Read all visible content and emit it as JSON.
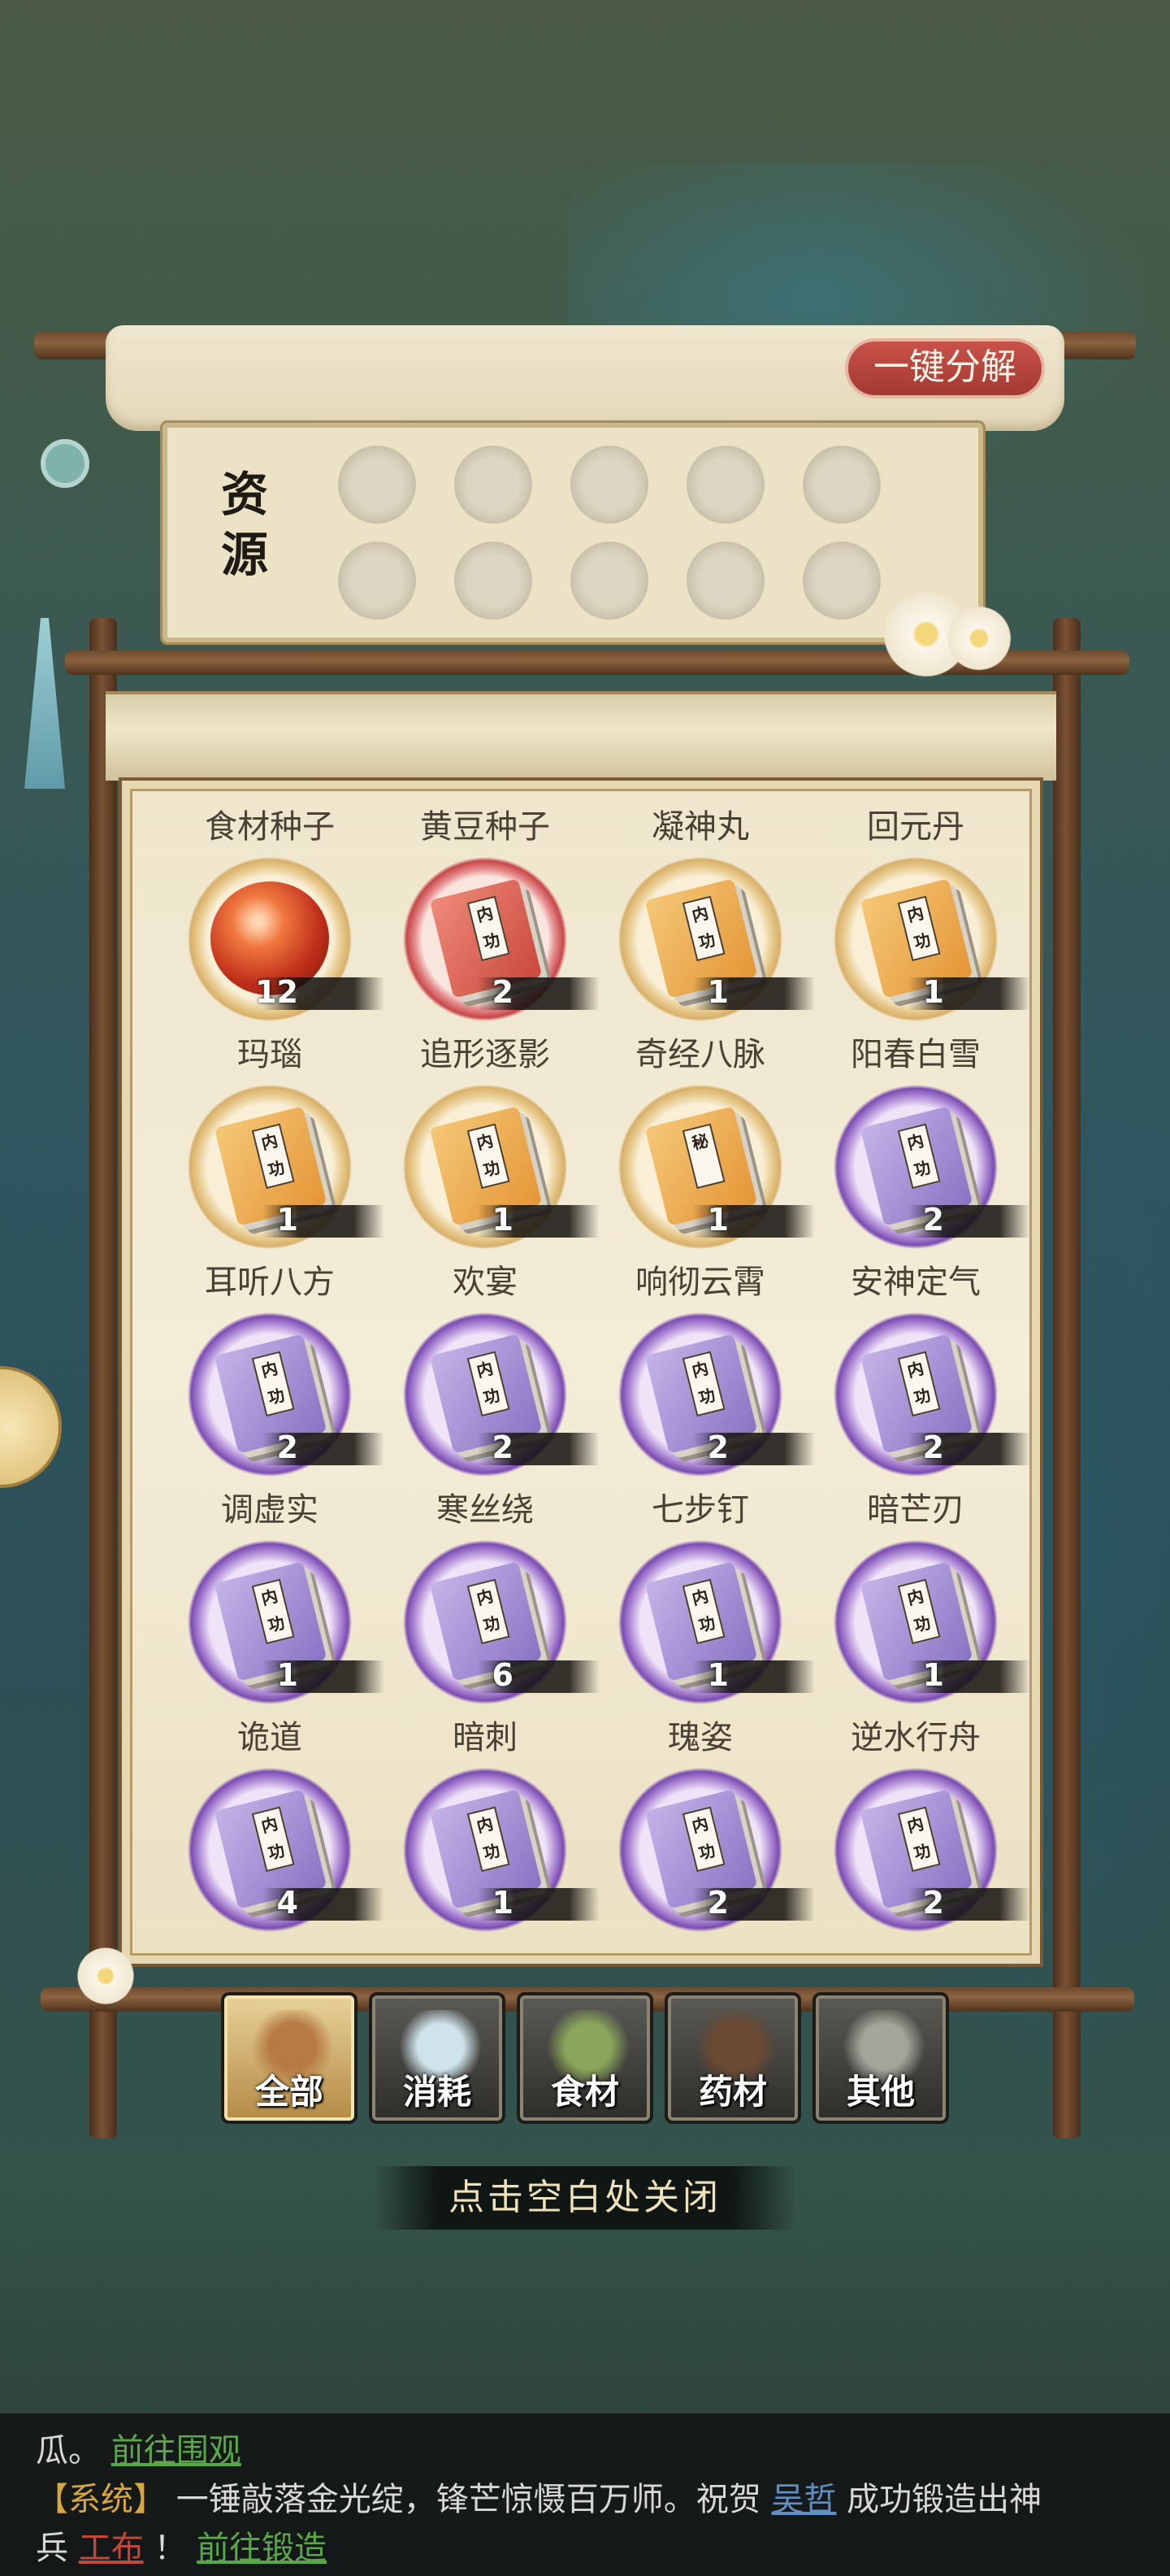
{
  "resources": {
    "title": "资源",
    "decompose_label": "一键分解",
    "slot_count": 10
  },
  "items": [
    {
      "name": "食材种子",
      "count": "12",
      "icon": "orb-icon",
      "rarity": "gold"
    },
    {
      "name": "黄豆种子",
      "count": "2",
      "icon": "book-icon",
      "rarity": "red",
      "book": "red",
      "tag": "内功"
    },
    {
      "name": "凝神丸",
      "count": "1",
      "icon": "book-icon",
      "rarity": "gold",
      "book": "orange",
      "tag": "内功"
    },
    {
      "name": "回元丹",
      "count": "1",
      "icon": "book-icon",
      "rarity": "gold",
      "book": "orange",
      "tag": "内功"
    },
    {
      "name": "玛瑙",
      "count": "1",
      "icon": "book-icon",
      "rarity": "gold",
      "book": "orange",
      "tag": "内功"
    },
    {
      "name": "追形逐影",
      "count": "1",
      "icon": "book-icon",
      "rarity": "gold",
      "book": "orange",
      "tag": "内功"
    },
    {
      "name": "奇经八脉",
      "count": "1",
      "icon": "book-icon",
      "rarity": "gold",
      "book": "orange",
      "tag": "秘"
    },
    {
      "name": "阳春白雪",
      "count": "2",
      "icon": "book-icon",
      "rarity": "purple",
      "book": "purple",
      "tag": "内功"
    },
    {
      "name": "耳听八方",
      "count": "2",
      "icon": "book-icon",
      "rarity": "purple",
      "book": "purple",
      "tag": "内功"
    },
    {
      "name": "欢宴",
      "count": "2",
      "icon": "book-icon",
      "rarity": "purple",
      "book": "purple",
      "tag": "内功"
    },
    {
      "name": "响彻云霄",
      "count": "2",
      "icon": "book-icon",
      "rarity": "purple",
      "book": "purple",
      "tag": "内功"
    },
    {
      "name": "安神定气",
      "count": "2",
      "icon": "book-icon",
      "rarity": "purple",
      "book": "purple",
      "tag": "内功"
    },
    {
      "name": "调虚实",
      "count": "1",
      "icon": "book-icon",
      "rarity": "purple",
      "book": "purple",
      "tag": "内功"
    },
    {
      "name": "寒丝绕",
      "count": "6",
      "icon": "book-icon",
      "rarity": "purple",
      "book": "purple",
      "tag": "内功"
    },
    {
      "name": "七步钉",
      "count": "1",
      "icon": "book-icon",
      "rarity": "purple",
      "book": "purple",
      "tag": "内功"
    },
    {
      "name": "暗芒刃",
      "count": "1",
      "icon": "book-icon",
      "rarity": "purple",
      "book": "purple",
      "tag": "内功"
    },
    {
      "name": "诡道",
      "count": "4",
      "icon": "book-icon",
      "rarity": "purple",
      "book": "purple",
      "tag": "内功"
    },
    {
      "name": "暗刺",
      "count": "1",
      "icon": "book-icon",
      "rarity": "purple",
      "book": "purple",
      "tag": "内功"
    },
    {
      "name": "瑰姿",
      "count": "2",
      "icon": "book-icon",
      "rarity": "purple",
      "book": "purple",
      "tag": "内功"
    },
    {
      "name": "逆水行舟",
      "count": "2",
      "icon": "book-icon",
      "rarity": "purple",
      "book": "purple",
      "tag": "内功"
    }
  ],
  "tabs": [
    {
      "label": "全部",
      "icon": "treasure-chest-icon",
      "active": true
    },
    {
      "label": "消耗",
      "icon": "potion-bottle-icon",
      "active": false
    },
    {
      "label": "食材",
      "icon": "vegetable-basket-icon",
      "active": false
    },
    {
      "label": "药材",
      "icon": "herb-pot-icon",
      "active": false
    },
    {
      "label": "其他",
      "icon": "bronze-vessel-icon",
      "active": false
    }
  ],
  "close_hint": "点击空白处关闭",
  "chat": {
    "line1_text": "瓜。",
    "line1_link": "前往围观",
    "line2_channel": "【系统】",
    "line2_text_a": "一锤敲落金光绽，锋芒惊慑百万师。祝贺",
    "line2_user": "吴哲",
    "line2_text_b": "成功锻造出神",
    "line3_text_a": "兵",
    "line3_item": "工布",
    "line3_text_b": "！",
    "line3_link": "前往锻造"
  },
  "colors": {
    "gold_rarity": "#d7b06a",
    "red_rarity": "#c7474a",
    "purple_rarity": "#7b4cb2",
    "link_green": "#5aa64a",
    "system_gold": "#d6a640",
    "user_blue": "#5f8fc4",
    "item_red": "#c4483a"
  }
}
